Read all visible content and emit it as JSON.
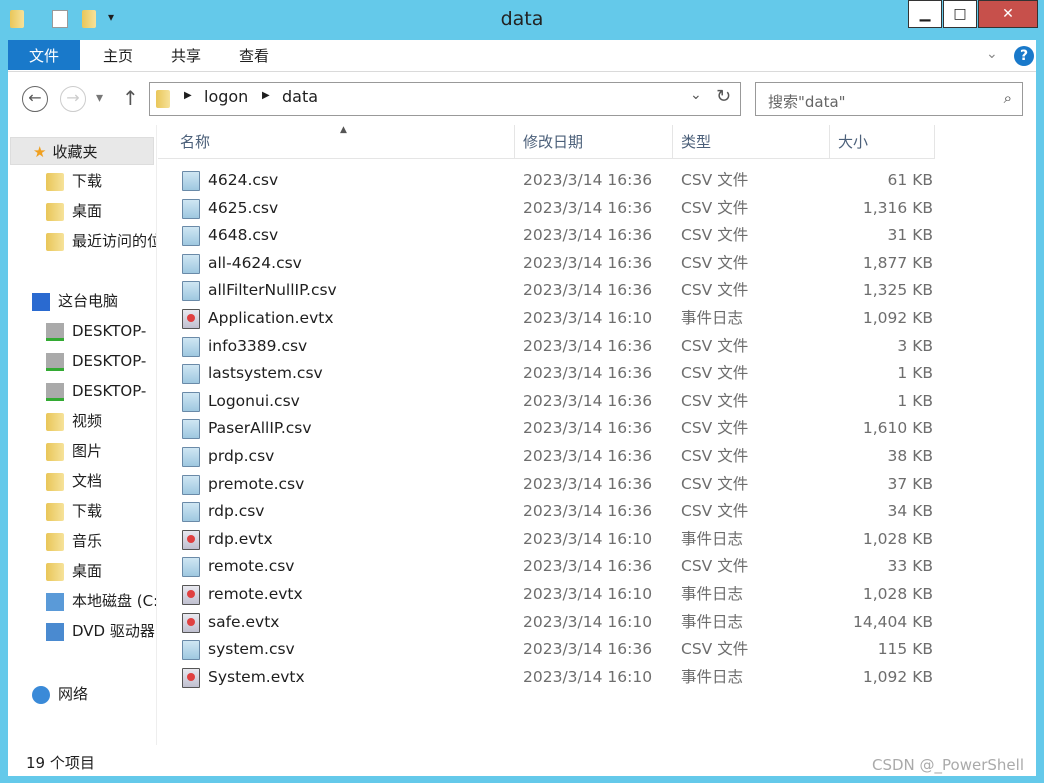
{
  "window": {
    "title": "data",
    "minimize": "▁",
    "maximize": "□",
    "close": "✕"
  },
  "ribbon": {
    "tabs": [
      "文件",
      "主页",
      "共享",
      "查看"
    ],
    "help": "?",
    "expand": "⌄"
  },
  "nav": {
    "back": "←",
    "forward": "→",
    "recent": "▾",
    "up": "↑"
  },
  "address": {
    "path": [
      "logon",
      "data"
    ],
    "dropdown": "⌄",
    "refresh": "↻"
  },
  "search": {
    "placeholder": "搜索\"data\""
  },
  "sidebar": {
    "favorites": {
      "label": "收藏夹",
      "items": [
        "下载",
        "桌面",
        "最近访问的位置"
      ]
    },
    "thispc": {
      "label": "这台电脑",
      "items": [
        "DESKTOP-",
        "DESKTOP-",
        "DESKTOP-",
        "视频",
        "图片",
        "文档",
        "下载",
        "音乐",
        "桌面",
        "本地磁盘 (C:)",
        "DVD 驱动器"
      ]
    },
    "network": {
      "label": "网络"
    }
  },
  "columns": [
    "名称",
    "修改日期",
    "类型",
    "大小"
  ],
  "files": [
    {
      "name": "4624.csv",
      "date": "2023/3/14 16:36",
      "type": "CSV 文件",
      "size": "61 KB",
      "kind": "csv"
    },
    {
      "name": "4625.csv",
      "date": "2023/3/14 16:36",
      "type": "CSV 文件",
      "size": "1,316 KB",
      "kind": "csv"
    },
    {
      "name": "4648.csv",
      "date": "2023/3/14 16:36",
      "type": "CSV 文件",
      "size": "31 KB",
      "kind": "csv"
    },
    {
      "name": "all-4624.csv",
      "date": "2023/3/14 16:36",
      "type": "CSV 文件",
      "size": "1,877 KB",
      "kind": "csv"
    },
    {
      "name": "allFilterNullIP.csv",
      "date": "2023/3/14 16:36",
      "type": "CSV 文件",
      "size": "1,325 KB",
      "kind": "csv"
    },
    {
      "name": "Application.evtx",
      "date": "2023/3/14 16:10",
      "type": "事件日志",
      "size": "1,092 KB",
      "kind": "evtx"
    },
    {
      "name": "info3389.csv",
      "date": "2023/3/14 16:36",
      "type": "CSV 文件",
      "size": "3 KB",
      "kind": "csv"
    },
    {
      "name": "lastsystem.csv",
      "date": "2023/3/14 16:36",
      "type": "CSV 文件",
      "size": "1 KB",
      "kind": "csv"
    },
    {
      "name": "Logonui.csv",
      "date": "2023/3/14 16:36",
      "type": "CSV 文件",
      "size": "1 KB",
      "kind": "csv"
    },
    {
      "name": "PaserAllIP.csv",
      "date": "2023/3/14 16:36",
      "type": "CSV 文件",
      "size": "1,610 KB",
      "kind": "csv"
    },
    {
      "name": "prdp.csv",
      "date": "2023/3/14 16:36",
      "type": "CSV 文件",
      "size": "38 KB",
      "kind": "csv"
    },
    {
      "name": "premote.csv",
      "date": "2023/3/14 16:36",
      "type": "CSV 文件",
      "size": "37 KB",
      "kind": "csv"
    },
    {
      "name": "rdp.csv",
      "date": "2023/3/14 16:36",
      "type": "CSV 文件",
      "size": "34 KB",
      "kind": "csv"
    },
    {
      "name": "rdp.evtx",
      "date": "2023/3/14 16:10",
      "type": "事件日志",
      "size": "1,028 KB",
      "kind": "evtx"
    },
    {
      "name": "remote.csv",
      "date": "2023/3/14 16:36",
      "type": "CSV 文件",
      "size": "33 KB",
      "kind": "csv"
    },
    {
      "name": "remote.evtx",
      "date": "2023/3/14 16:10",
      "type": "事件日志",
      "size": "1,028 KB",
      "kind": "evtx"
    },
    {
      "name": "safe.evtx",
      "date": "2023/3/14 16:10",
      "type": "事件日志",
      "size": "14,404 KB",
      "kind": "evtx"
    },
    {
      "name": "system.csv",
      "date": "2023/3/14 16:36",
      "type": "CSV 文件",
      "size": "115 KB",
      "kind": "csv"
    },
    {
      "name": "System.evtx",
      "date": "2023/3/14 16:10",
      "type": "事件日志",
      "size": "1,092 KB",
      "kind": "evtx"
    }
  ],
  "status": {
    "count": "19 个项目"
  },
  "watermark": "CSDN @_PowerShell",
  "colors": {
    "frame": "#64c9ea",
    "file_tab": "#1979ca"
  }
}
